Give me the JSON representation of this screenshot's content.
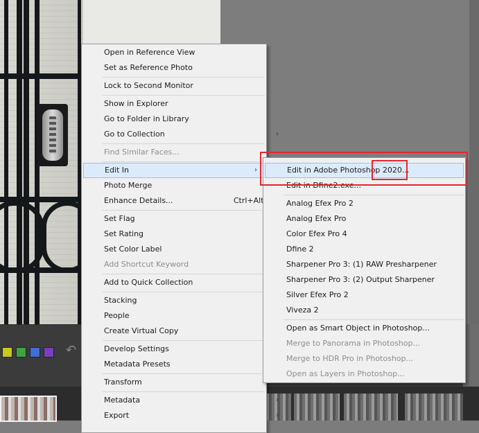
{
  "main_menu": {
    "items": [
      {
        "label": "Open in Reference View"
      },
      {
        "label": "Set as Reference Photo"
      },
      {
        "label": "Lock to Second Monitor"
      },
      {
        "label": "Show in Explorer"
      },
      {
        "label": "Go to Folder in Library"
      },
      {
        "label": "Go to Collection",
        "submenu": true
      },
      {
        "label": "Find Similar Faces...",
        "disabled": true
      },
      {
        "label": "Edit In",
        "submenu": true,
        "highlighted": true
      },
      {
        "label": "Photo Merge",
        "submenu": true
      },
      {
        "label": "Enhance Details...",
        "shortcut": "Ctrl+Alt+I"
      },
      {
        "label": "Set Flag",
        "submenu": true
      },
      {
        "label": "Set Rating",
        "submenu": true
      },
      {
        "label": "Set Color Label",
        "submenu": true
      },
      {
        "label": "Add Shortcut Keyword",
        "disabled": true
      },
      {
        "label": "Add to Quick Collection"
      },
      {
        "label": "Stacking",
        "submenu": true
      },
      {
        "label": "People",
        "submenu": true
      },
      {
        "label": "Create Virtual Copy"
      },
      {
        "label": "Develop Settings",
        "submenu": true
      },
      {
        "label": "Metadata Presets",
        "submenu": true
      },
      {
        "label": "Transform",
        "submenu": true
      },
      {
        "label": "Metadata",
        "submenu": true
      },
      {
        "label": "Export",
        "submenu": true
      }
    ],
    "arrow_glyph": "›"
  },
  "edit_in_submenu": {
    "items": [
      {
        "label": "Edit in Adobe Photoshop 2020...",
        "highlighted": true
      },
      {
        "label": "Edit in Dfine2.exe..."
      },
      {
        "label": "Analog Efex Pro 2"
      },
      {
        "label": "Analog Efex Pro"
      },
      {
        "label": "Color Efex Pro 4"
      },
      {
        "label": "Dfine 2"
      },
      {
        "label": "Sharpener Pro 3: (1) RAW Presharpener"
      },
      {
        "label": "Sharpener Pro 3: (2) Output Sharpener"
      },
      {
        "label": "Silver Efex Pro 2"
      },
      {
        "label": "Viveza 2"
      },
      {
        "label": "Open as Smart Object in Photoshop..."
      },
      {
        "label": "Merge to Panorama in Photoshop...",
        "disabled": true
      },
      {
        "label": "Merge to HDR Pro in Photoshop...",
        "disabled": true
      },
      {
        "label": "Open as Layers in Photoshop...",
        "disabled": true
      }
    ]
  },
  "color_labels": [
    "#c8c81e",
    "#3fa43f",
    "#3f6fd0",
    "#7a3fc0"
  ],
  "annotation_color": "#e3272f",
  "menu_highlight_color": "#dcebfc"
}
